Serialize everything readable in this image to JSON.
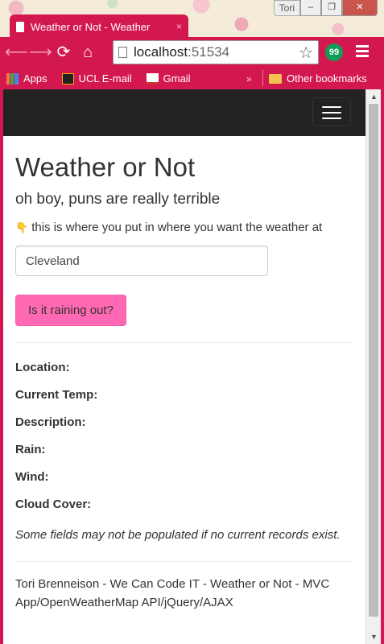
{
  "browser": {
    "tab_title": "Weather or Not - Weather",
    "tab_close": "×",
    "user_name": "Tori",
    "url_host": "localhost",
    "url_port": ":51534",
    "hangouts_label": "99",
    "bookmarks": [
      {
        "label": "Apps",
        "icon": "apps-grid-icon"
      },
      {
        "label": "UCL E-mail",
        "icon": "ucl-icon"
      },
      {
        "label": "Gmail",
        "icon": "gmail-icon"
      }
    ],
    "bookmarks_more": "»",
    "other_bookmarks": "Other bookmarks",
    "accent_color": "#d3184f"
  },
  "page": {
    "title": "Weather or Not",
    "subtitle": "oh boy, puns are really terrible",
    "hint": "this is where you put in where you want the weather at",
    "input_value": "Cleveland",
    "button_label": "Is it raining out?",
    "button_color": "#ff69b4",
    "fields": {
      "location": "Location:",
      "current_temp": "Current Temp:",
      "description": "Description:",
      "rain": "Rain:",
      "wind": "Wind:",
      "cloud_cover": "Cloud Cover:"
    },
    "note": "Some fields may not be populated if no current records exist.",
    "footer": "Tori Brenneison - We Can Code IT - Weather or Not - MVC App/OpenWeatherMap API/jQuery/AJAX",
    "navbar_color": "#222222"
  }
}
